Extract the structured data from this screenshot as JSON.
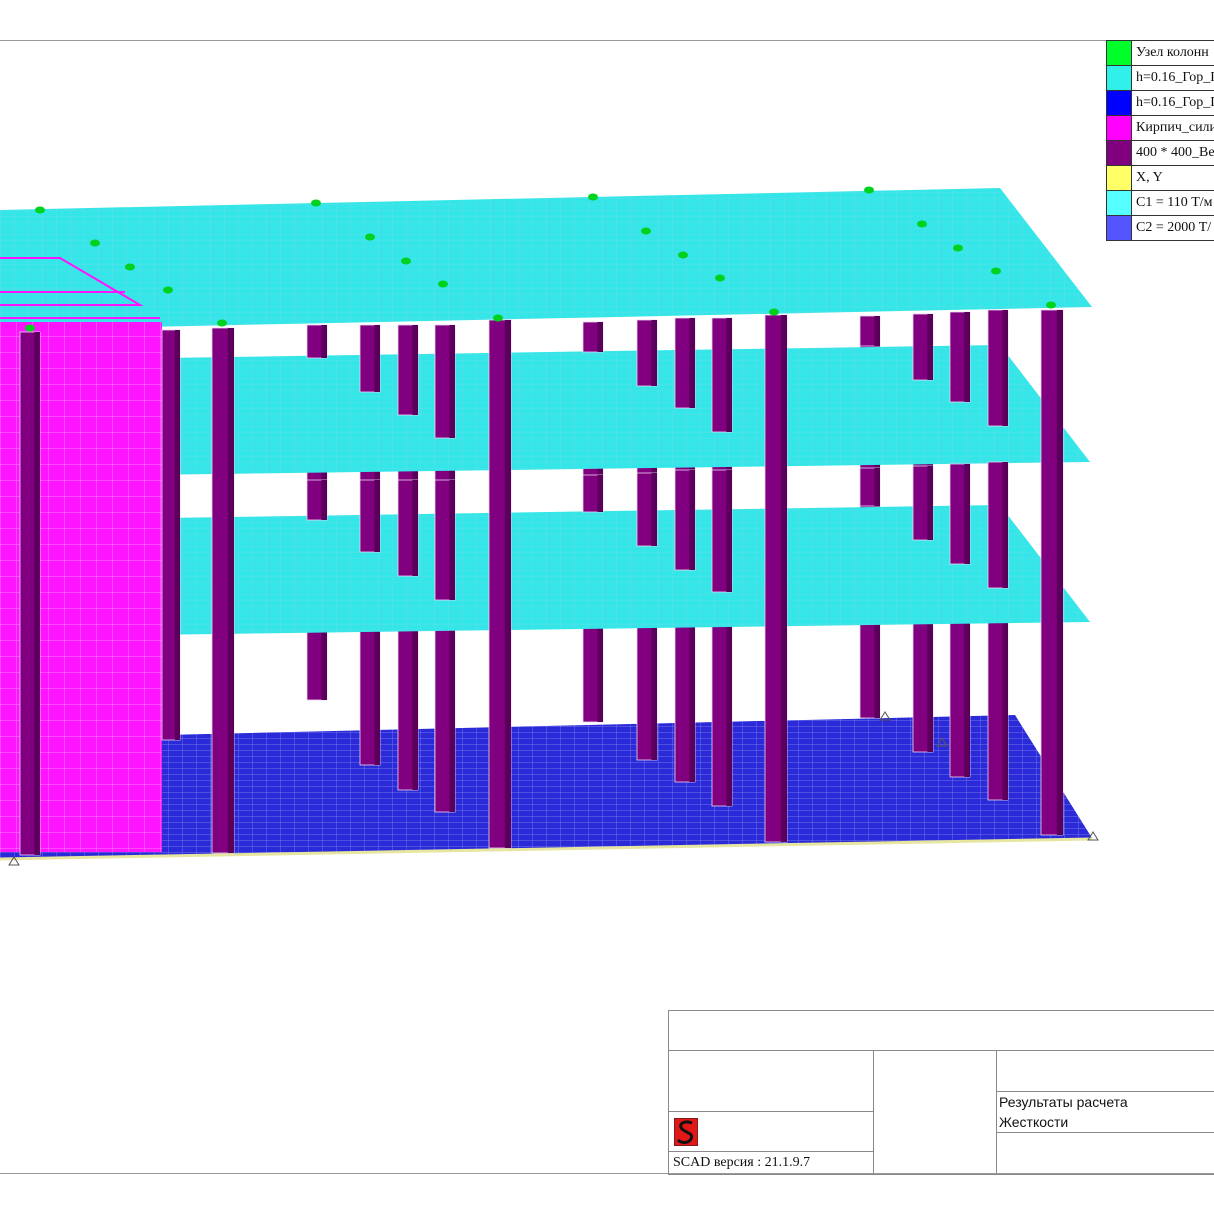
{
  "legend": {
    "items": [
      {
        "label": "Узел колонн",
        "color": "#00ff2a"
      },
      {
        "label": "h=0.16_Гор_Г",
        "color": "#30f0ea"
      },
      {
        "label": "h=0.16_Гор_Г",
        "color": "#0000ff"
      },
      {
        "label": "Кирпич_сили",
        "color": "#ff00ff"
      },
      {
        "label": "400 * 400_Ве",
        "color": "#800080"
      },
      {
        "label": "X, Y",
        "color": "#ffff66"
      },
      {
        "label": "C1 = 110 Т/м",
        "color": "#55ffff"
      },
      {
        "label": "C2 = 2000 Т/",
        "color": "#5555ff"
      }
    ]
  },
  "stamp": {
    "version": "SCAD версия : 21.1.9.7",
    "result_title": "Результаты расчета",
    "result_type": "Жесткости"
  },
  "colors": {
    "slab": "#34e6e8",
    "slab_grid": "#6fd8e6",
    "foundation": "#2a2ad8",
    "wall": "#ff14ff",
    "column": "#800080",
    "column_dark": "#5a005a",
    "node": "#00d21e"
  }
}
